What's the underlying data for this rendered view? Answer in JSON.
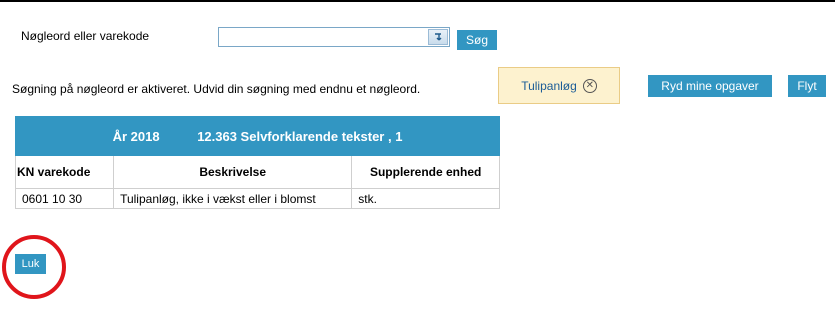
{
  "search": {
    "label": "Nøgleord eller varekode",
    "value": "",
    "placeholder": "",
    "keyboard_icon": "keyboard-icon",
    "search_button": "Søg"
  },
  "info": {
    "message": "Søgning på nøgleord er aktiveret. Udvid din søgning med endnu et nøgleord."
  },
  "tag": {
    "label": "Tulipanløg",
    "remove_icon": "⊗"
  },
  "actions": {
    "clear_tasks": "Ryd mine opgaver",
    "move": "Flyt",
    "close": "Luk"
  },
  "table": {
    "year": "År 2018",
    "title": "12.363 Selvforklarende tekster , 1",
    "headers": [
      "KN varekode",
      "Beskrivelse",
      "Supplerende enhed"
    ],
    "rows": [
      [
        "0601 10 30",
        "Tulipanløg, ikke i vækst eller i blomst",
        "stk."
      ]
    ]
  },
  "colors": {
    "accent": "#3296c2",
    "tag_bg": "#fdf2cf",
    "annotation": "#e0151b"
  }
}
